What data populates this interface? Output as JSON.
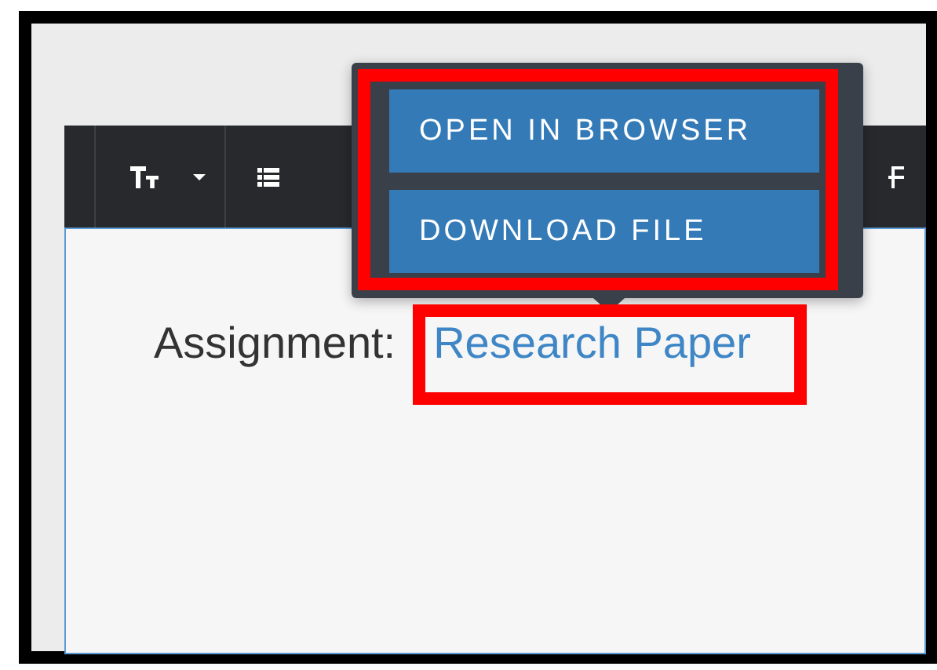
{
  "popover": {
    "buttons": [
      {
        "label": "OPEN IN BROWSER"
      },
      {
        "label": "DOWNLOAD FILE"
      }
    ]
  },
  "content": {
    "label": "Assignment:",
    "link": "Research Paper"
  }
}
